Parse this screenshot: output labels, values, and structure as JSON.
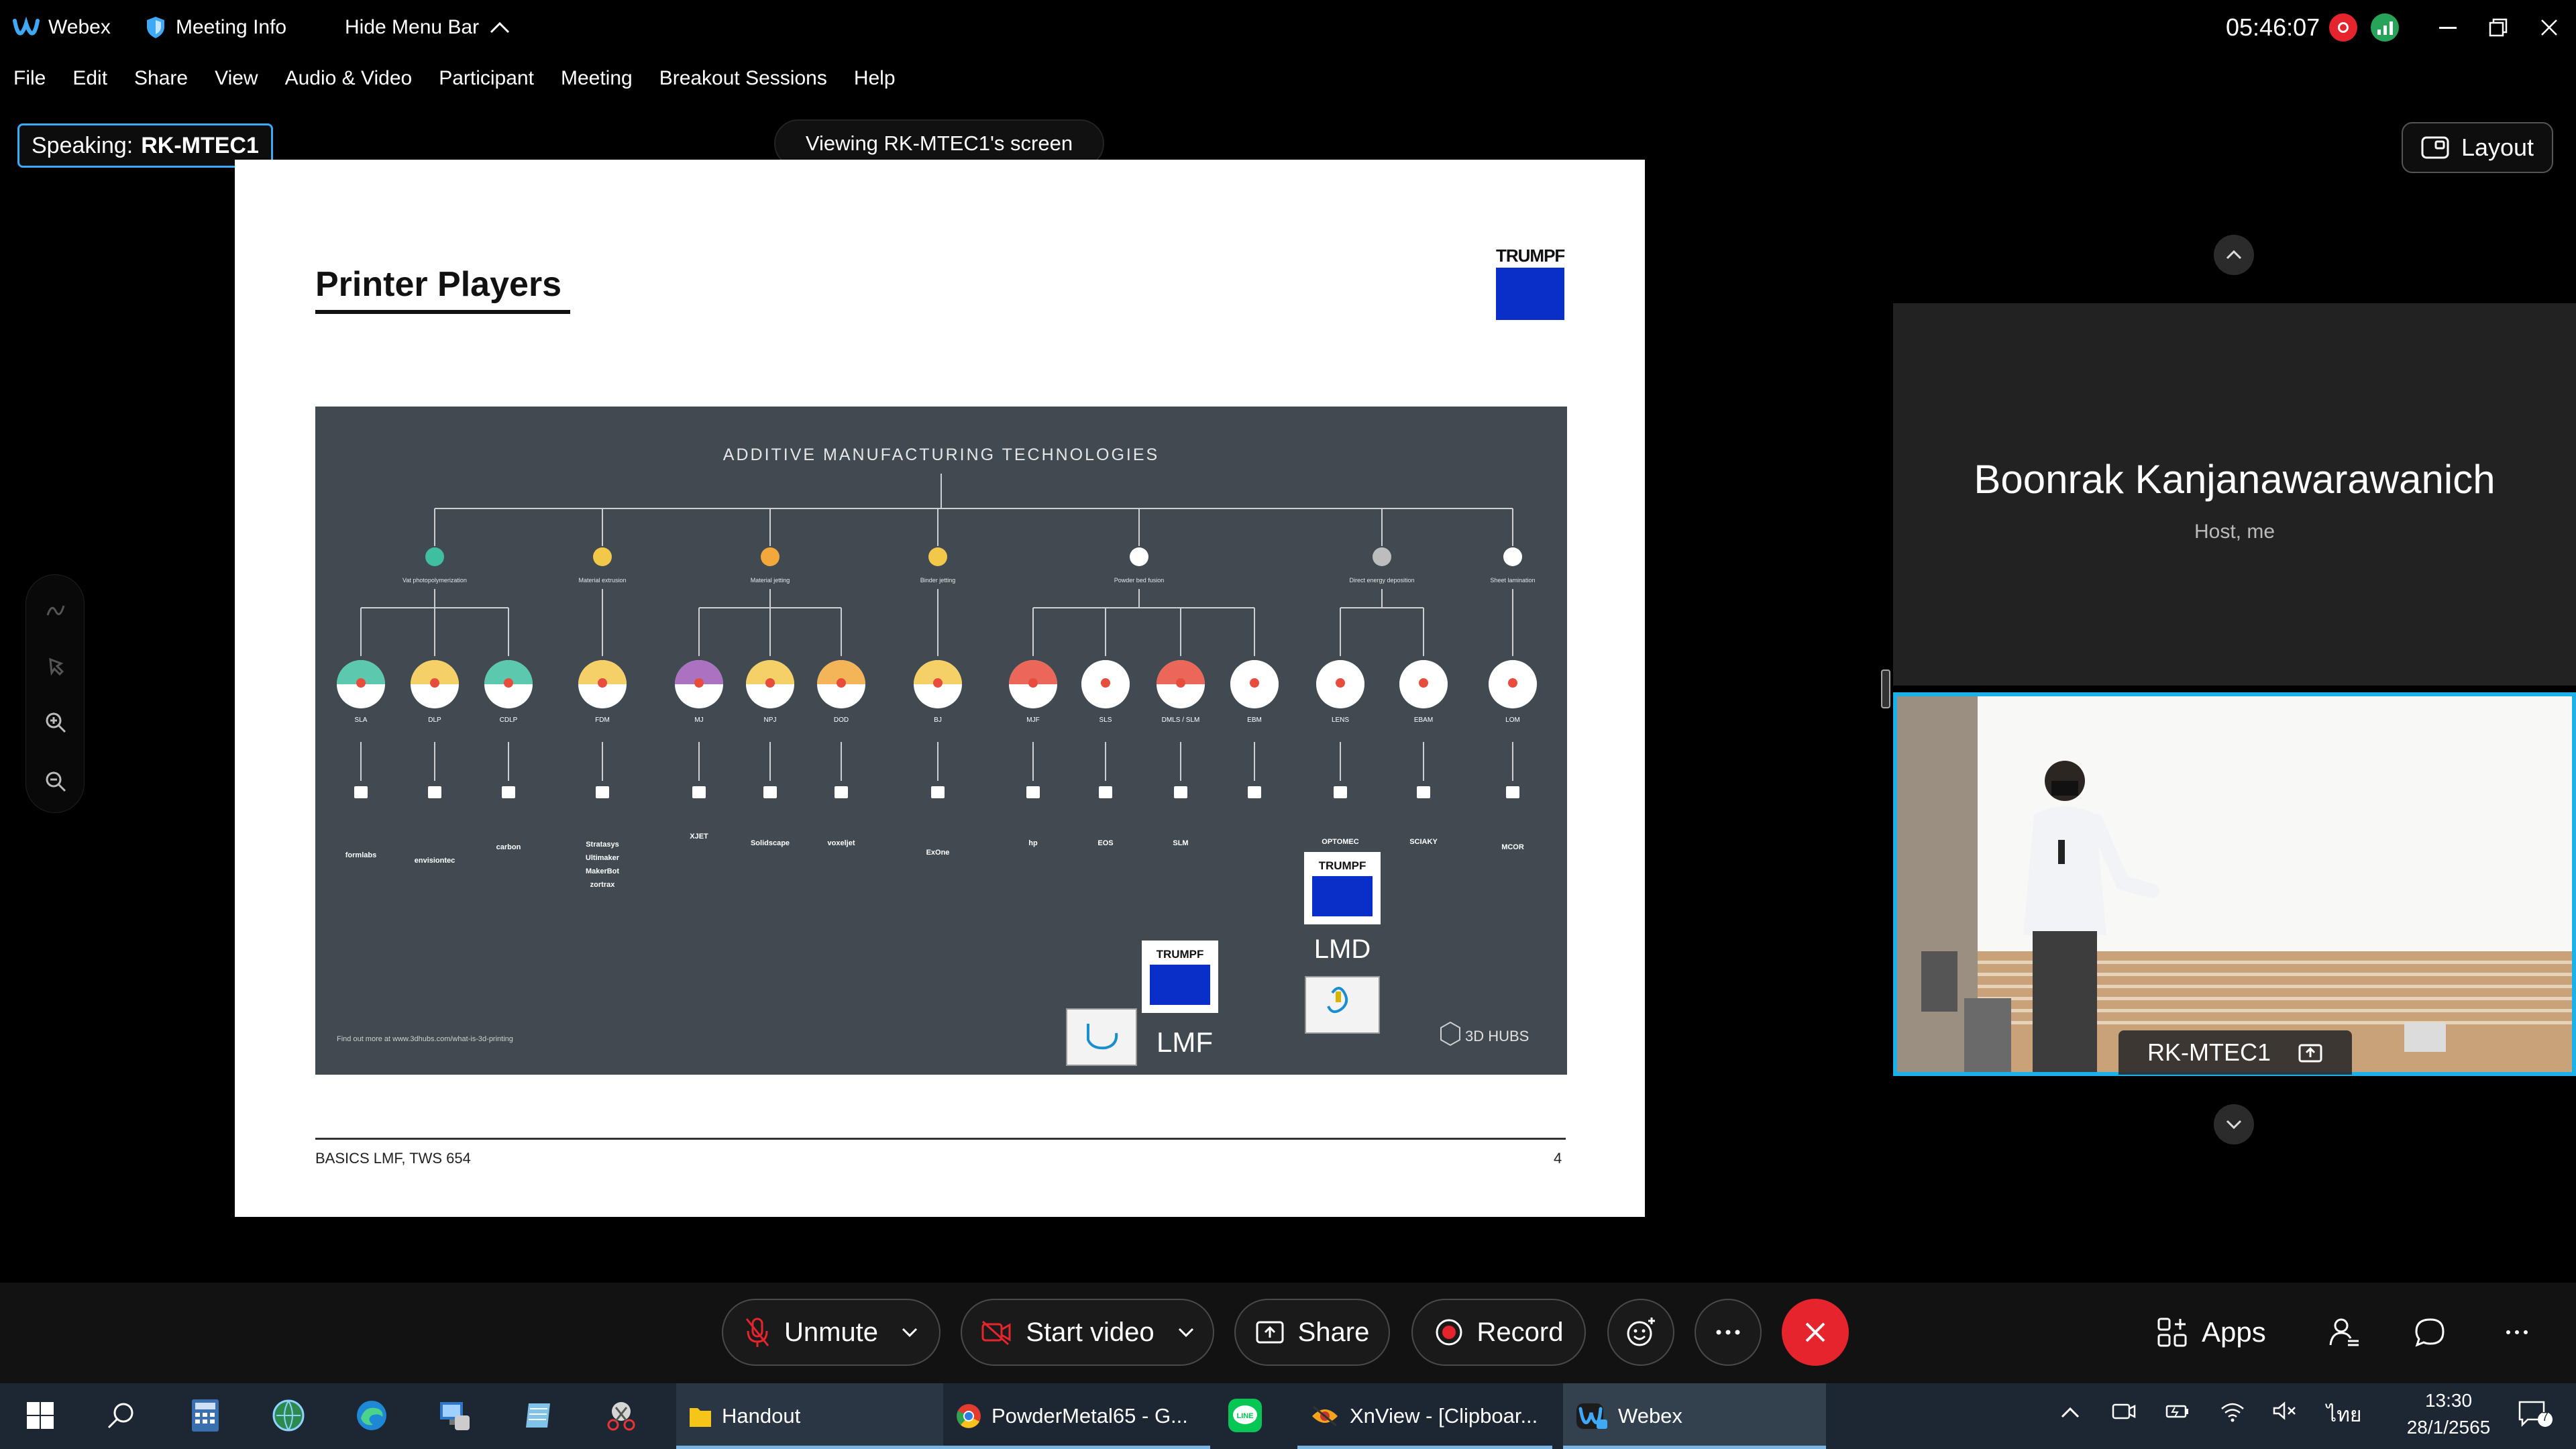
{
  "titlebar": {
    "app_name": "Webex",
    "meeting_info": "Meeting Info",
    "hide_menu_bar": "Hide Menu Bar",
    "clock": "05:46:07"
  },
  "menu": [
    "File",
    "Edit",
    "Share",
    "View",
    "Audio & Video",
    "Participant",
    "Meeting",
    "Breakout Sessions",
    "Help"
  ],
  "stage": {
    "speaking_label": "Speaking:",
    "speaking_name": "RK-MTEC1",
    "viewing_banner": "Viewing RK-MTEC1's screen",
    "layout_label": "Layout"
  },
  "slide": {
    "title": "Printer Players",
    "logo_text": "TRUMPF",
    "panel_title": "ADDITIVE MANUFACTURING TECHNOLOGIES",
    "categories": [
      "Vat photopolymerization",
      "Material extrusion",
      "Material jetting",
      "Binder jetting",
      "Powder bed fusion",
      "Direct energy deposition",
      "Sheet lamination"
    ],
    "processes": [
      "SLA",
      "DLP",
      "CDLP",
      "FDM",
      "MJ",
      "NPJ",
      "DOD",
      "BJ",
      "MJF",
      "SLS",
      "DMLS / SLM",
      "EBM",
      "LENS",
      "EBAM",
      "LOM"
    ],
    "brands": [
      "formlabs",
      "envisiontec",
      "carbon",
      "Stratasys",
      "Ultimaker",
      "MakerBot",
      "zortrax",
      "XJET",
      "Solidscape",
      "voxeljet",
      "ExOne",
      "hp",
      "EOS",
      "SLM",
      "OPTOMEC",
      "SCIAKY",
      "MCOR"
    ],
    "trumpf_label": "TRUMPF",
    "lmd_label": "LMD",
    "lmf_label": "LMF",
    "hubs_label": "3D HUBS",
    "panel_footer": "Find out more at www.3dhubs.com/what-is-3d-printing",
    "footer_left": "BASICS LMF, TWS 654",
    "footer_right": "4"
  },
  "participants": {
    "host_name": "Boonrak Kanjanawarawanich",
    "host_role": "Host, me",
    "video_name": "RK-MTEC1"
  },
  "controls": {
    "unmute": "Unmute",
    "start_video": "Start video",
    "share": "Share",
    "record": "Record",
    "apps": "Apps"
  },
  "taskbar": {
    "apps": [
      {
        "label": "Handout"
      },
      {
        "label": "PowderMetal65 - G..."
      },
      {
        "label": "XnView - [Clipboar..."
      },
      {
        "label": "Webex"
      }
    ],
    "lang": "ไทย",
    "time": "13:30",
    "date": "28/1/2565",
    "notif_count": "7"
  },
  "colors": {
    "accent_blue": "#1bb0e8",
    "trumpf_blue": "#0a2fc9",
    "leave_red": "#e5242d",
    "panel_gray": "#414a51"
  }
}
